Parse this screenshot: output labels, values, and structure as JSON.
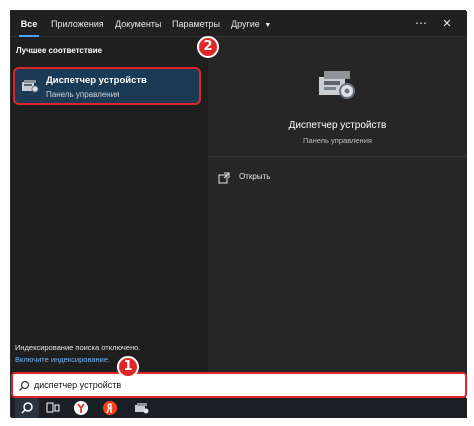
{
  "tabs": {
    "all": "Все",
    "apps": "Приложения",
    "documents": "Документы",
    "settings": "Параметры",
    "other": "Другие",
    "more_icon": "ellipsis-icon",
    "close_icon": "close-icon"
  },
  "left": {
    "section_title": "Лучшее соответствие",
    "best_match": {
      "title": "Диспетчер устройств",
      "subtitle": "Панель управления"
    },
    "index_note": "Индексирование поиска отключено.",
    "index_link": "Включите индексирование."
  },
  "right": {
    "title": "Диспетчер устройств",
    "subtitle": "Панель управления",
    "actions": [
      {
        "label": "Открыть",
        "icon": "open-icon"
      }
    ]
  },
  "search": {
    "value": "диспетчер устройств",
    "icon": "search-icon"
  },
  "badges": {
    "one": "1",
    "two": "2"
  },
  "colors": {
    "accent": "#4da3ff",
    "highlight": "#e0262a",
    "selected_bg": "#1b3a55"
  }
}
